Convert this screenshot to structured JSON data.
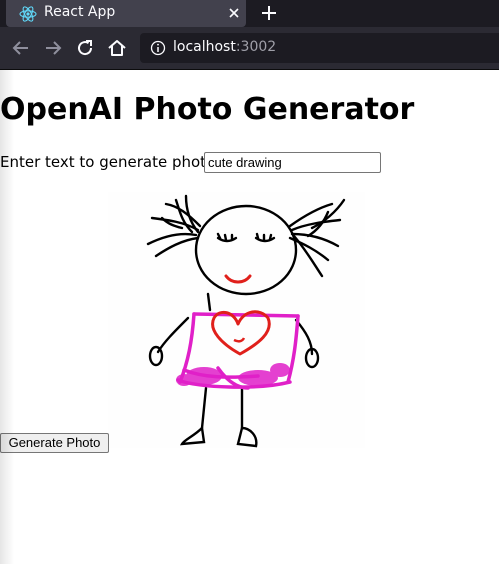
{
  "browser": {
    "tab_title": "React App",
    "tab_icon": "react-logo-icon",
    "url_host": "localhost",
    "url_port": ":3002",
    "colors": {
      "tabbar": "#1c1b22",
      "navbar": "#2b2a33",
      "react_logo": "#61dafb"
    }
  },
  "page": {
    "title": "OpenAI Photo Generator",
    "prompt_label": "Enter text to generate photo:",
    "prompt_value": "cute drawing",
    "generate_button": "Generate Photo",
    "image": {
      "icon": "child-drawing-image",
      "colors": {
        "lines": "#000000",
        "smile_heart": "#e0201b",
        "dress": "#e020c8"
      }
    }
  }
}
